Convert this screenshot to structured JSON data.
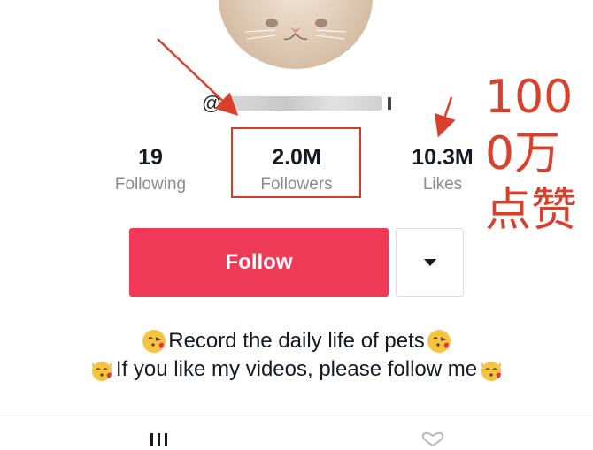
{
  "profile": {
    "username_prefix": "@"
  },
  "stats": [
    {
      "value": "19",
      "label": "Following"
    },
    {
      "value": "2.0M",
      "label": "Followers"
    },
    {
      "value": "10.3M",
      "label": "Likes"
    }
  ],
  "annotation": {
    "lines": [
      "100",
      "0万",
      "点赞"
    ],
    "color": "#d9402b"
  },
  "actions": {
    "follow_label": "Follow",
    "more_icon": "caret-down-icon"
  },
  "bio": {
    "line1": "Record the daily life of pets",
    "line2": "If you like my videos, please follow me"
  },
  "tabs": [
    {
      "icon": "videos-grid-icon"
    },
    {
      "icon": "liked-heart-icon"
    }
  ],
  "colors": {
    "accent": "#ee3a56",
    "text": "#161823",
    "muted": "#8a8b91"
  }
}
